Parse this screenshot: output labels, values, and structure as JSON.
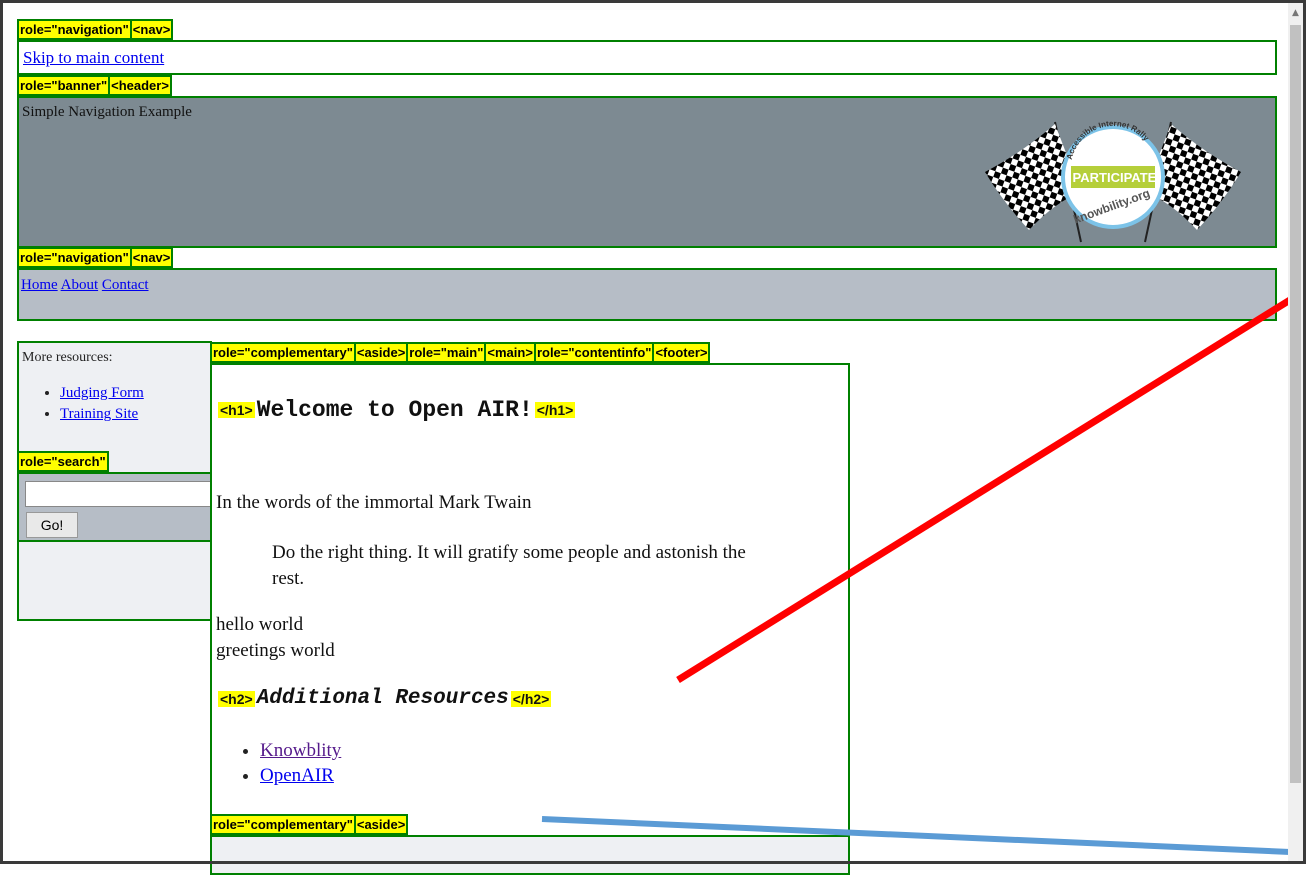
{
  "annotations": {
    "nav_top": [
      "role=\"navigation\"",
      "<nav>"
    ],
    "banner": [
      "role=\"banner\"",
      "<header>"
    ],
    "nav_main": [
      "role=\"navigation\"",
      "<nav>"
    ],
    "main_region": [
      "role=\"complementary\"",
      "<aside>",
      "role=\"main\"",
      "<main>",
      "role=\"contentinfo\"",
      "<footer>"
    ],
    "search": "role=\"search\"",
    "aside_bottom": [
      "role=\"complementary\"",
      "<aside>"
    ],
    "h1_open": "<h1>",
    "h1_close": "</h1>",
    "h2_open": "<h2>",
    "h2_close": "</h2>"
  },
  "skip_link": "Skip to main content",
  "banner": {
    "site_title": "Simple Navigation Example",
    "logo": {
      "arc_text": "Accessible Internet Rally",
      "main_text": "I PARTICIPATE!",
      "bottom_text": "knowbility.org"
    }
  },
  "main_nav": [
    "Home",
    "About",
    "Contact"
  ],
  "sidebar": {
    "title": "More resources:",
    "links": [
      "Judging Form",
      "Training Site"
    ],
    "search_value": "",
    "search_button": "Go!"
  },
  "main": {
    "h1": "Welcome to Open AIR!",
    "intro": "In the words of the immortal Mark Twain",
    "quote": "Do the right thing. It will gratify some people and astonish the rest.",
    "line1": "hello world",
    "line2": "greetings world",
    "h2": "Additional Resources",
    "resources": [
      "Knowblity",
      "OpenAIR"
    ]
  },
  "colors": {
    "tag_bg": "#ffff00",
    "tag_border": "#008000",
    "banner_bg": "#7d8a92",
    "nav_bg": "#b6bdc6",
    "red_annotation": "#ff0000",
    "blue_annotation": "#5b9bd5"
  }
}
